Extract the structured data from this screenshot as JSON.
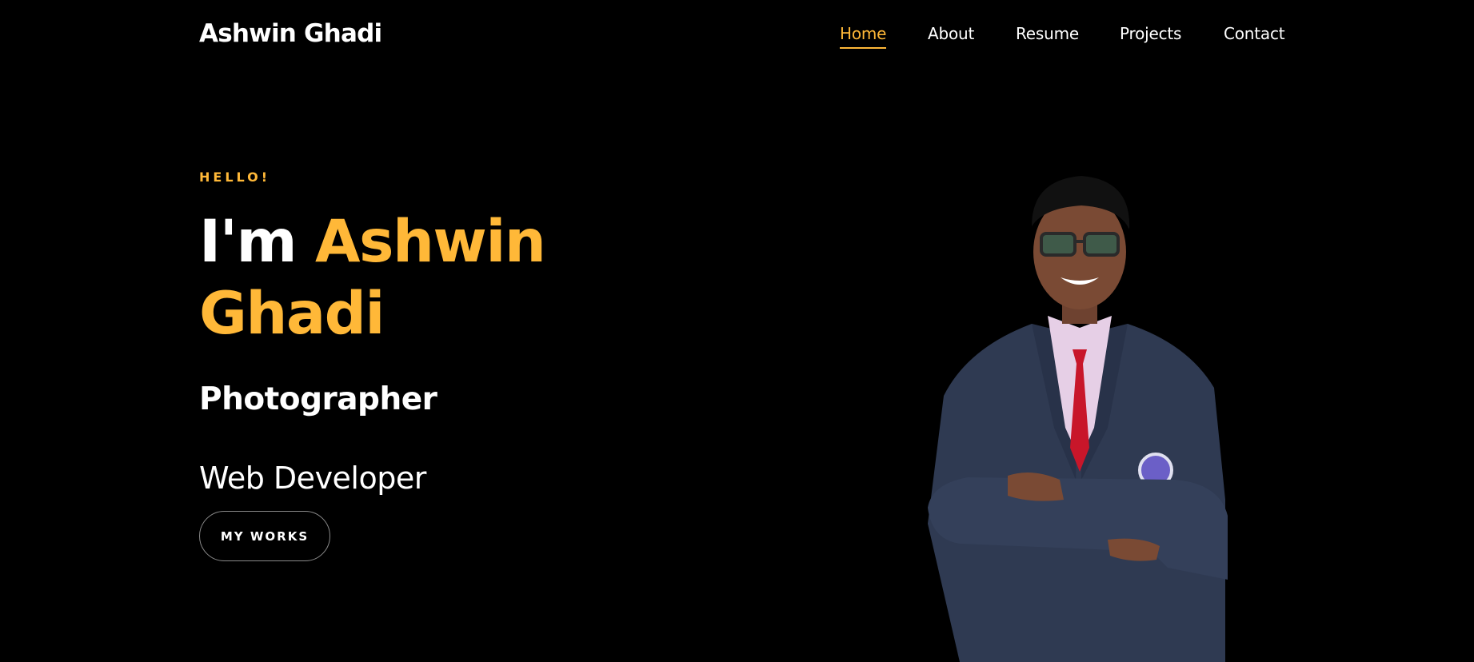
{
  "header": {
    "brand": "Ashwin Ghadi",
    "nav": [
      {
        "label": "Home",
        "active": true
      },
      {
        "label": "About",
        "active": false
      },
      {
        "label": "Resume",
        "active": false
      },
      {
        "label": "Projects",
        "active": false
      },
      {
        "label": "Contact",
        "active": false
      }
    ]
  },
  "hero": {
    "greeting": "HELLO!",
    "headline_prefix": "I'm",
    "headline_name": "Ashwin Ghadi",
    "role_primary": "Photographer",
    "role_secondary": "Web Developer",
    "cta_label": "MY WORKS"
  },
  "portrait": {
    "icon": "person-portrait"
  },
  "colors": {
    "background": "#000000",
    "accent": "#ffb838",
    "text": "#ffffff",
    "button_border": "#8a8a8a"
  }
}
